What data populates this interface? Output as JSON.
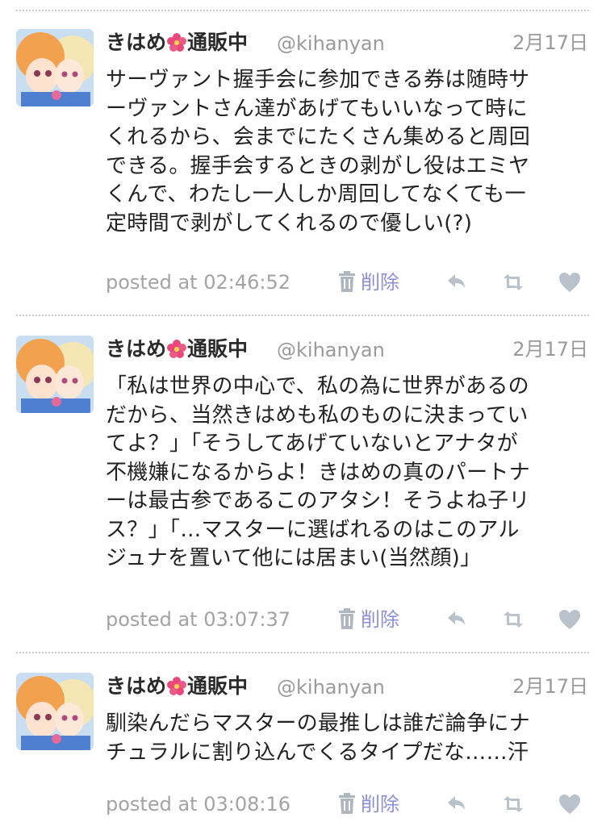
{
  "colors": {
    "text": "#222222",
    "meta": "#a3a3a3",
    "delete": "#8d8fd6",
    "action_icon": "#b9c2cb",
    "divider": "#c9c9c9"
  },
  "icons": [
    "avatar-image",
    "hibiscus-icon",
    "trash-icon",
    "reply-icon",
    "retweet-icon",
    "heart-icon"
  ],
  "tweets": [
    {
      "display_name": "きはめ",
      "display_name_suffix": "通販中",
      "handle": "@kihanyan",
      "date": "2月17日",
      "text": "サーヴァント握手会に参加できる券は随時サ\nーヴァントさん達があげてもいいなって時に\nくれるから、会までにたくさん集めると周回\nできる。握手会するときの剥がし役はエミヤ\nくんで、わたし一人しか周回してなくても一\n定時間で剥がしてくれるので優しい(?)",
      "posted": "posted at 02:46:52",
      "delete_label": "削除"
    },
    {
      "display_name": "きはめ",
      "display_name_suffix": "通販中",
      "handle": "@kihanyan",
      "date": "2月17日",
      "text": "「私は世界の中心で、私の為に世界があるの\nだから、当然きはめも私のものに決まってい\nてよ？」「そうしてあげていないとアナタが\n不機嫌になるからよ！きはめの真のパートナ\nーは最古参であるこのアタシ！そうよね子リ\nス？」「…マスターに選ばれるのはこのアル\nジュナを置いて他には居まい(当然顔)」",
      "posted": "posted at 03:07:37",
      "delete_label": "削除"
    },
    {
      "display_name": "きはめ",
      "display_name_suffix": "通販中",
      "handle": "@kihanyan",
      "date": "2月17日",
      "text": "馴染んだらマスターの最推しは誰だ論争にナ\nチュラルに割り込んでくるタイプだな……汗",
      "posted": "posted at 03:08:16",
      "delete_label": "削除"
    }
  ]
}
